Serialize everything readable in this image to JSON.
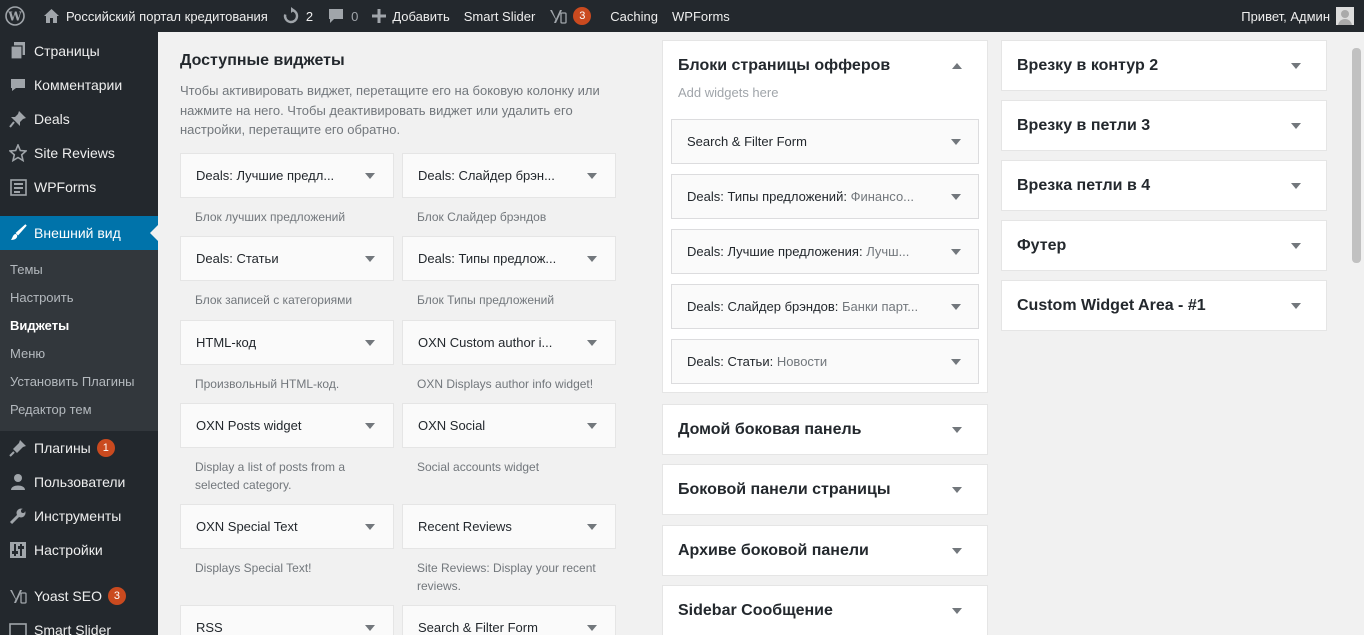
{
  "adminbar": {
    "site_name": "Российский портал кредитования",
    "updates_count": "2",
    "comments_count": "0",
    "add_label": "Добавить",
    "smart_slider_label": "Smart Slider",
    "yoast_count": "3",
    "caching_label": "Caching",
    "wpforms_label": "WPForms",
    "greeting": "Привет, Админ"
  },
  "sidebar": {
    "items_top": [
      {
        "label": "Страницы",
        "icon": "pages-icon"
      },
      {
        "label": "Комментарии",
        "icon": "comments-icon"
      },
      {
        "label": "Deals",
        "icon": "pin-icon"
      },
      {
        "label": "Site Reviews",
        "icon": "star-icon"
      },
      {
        "label": "WPForms",
        "icon": "forms-icon"
      }
    ],
    "current": {
      "label": "Внешний вид",
      "icon": "brush-icon"
    },
    "submenu": [
      "Темы",
      "Настроить",
      "Виджеты",
      "Меню",
      "Установить Плагины",
      "Редактор тем"
    ],
    "submenu_current": "Виджеты",
    "items_bottom": [
      {
        "label": "Плагины",
        "icon": "plugins-icon",
        "badge": "1"
      },
      {
        "label": "Пользователи",
        "icon": "users-icon"
      },
      {
        "label": "Инструменты",
        "icon": "tools-icon"
      },
      {
        "label": "Настройки",
        "icon": "settings-icon"
      }
    ],
    "yoast": {
      "label": "Yoast SEO",
      "badge": "3"
    },
    "smart_slider": {
      "label": "Smart Slider"
    }
  },
  "available": {
    "title": "Доступные виджеты",
    "description": "Чтобы активировать виджет, перетащите его на боковую колонку или нажмите на него. Чтобы деактивировать виджет или удалить его настройки, перетащите его обратно.",
    "widgets": [
      {
        "title": "Deals: Лучшие предл...",
        "desc": "Блок лучших предложений"
      },
      {
        "title": "Deals: Слайдер брэн...",
        "desc": "Блок Слайдер брэндов"
      },
      {
        "title": "Deals: Статьи",
        "desc": "Блок записей с категориями"
      },
      {
        "title": "Deals: Типы предлож...",
        "desc": "Блок Типы предложений"
      },
      {
        "title": "HTML-код",
        "desc": "Произвольный HTML-код."
      },
      {
        "title": "OXN Custom author i...",
        "desc": "OXN Displays author info widget!"
      },
      {
        "title": "OXN Posts widget",
        "desc": "Display a list of posts from a selected category."
      },
      {
        "title": "OXN Social",
        "desc": "Social accounts widget"
      },
      {
        "title": "OXN Special Text",
        "desc": "Displays Special Text!"
      },
      {
        "title": "Recent Reviews",
        "desc": "Site Reviews: Display your recent reviews."
      },
      {
        "title": "RSS",
        "desc": ""
      },
      {
        "title": "Search & Filter Form",
        "desc": ""
      }
    ]
  },
  "offers_area": {
    "title": "Блоки страницы офферов",
    "hint": "Add widgets here",
    "widgets": [
      {
        "title": "Search & Filter Form",
        "sub": ""
      },
      {
        "title": "Deals: Типы предложений:",
        "sub": " Финансо..."
      },
      {
        "title": "Deals: Лучшие предложения:",
        "sub": " Лучш..."
      },
      {
        "title": "Deals: Слайдер брэндов:",
        "sub": " Банки парт..."
      },
      {
        "title": "Deals: Статьи:",
        "sub": " Новости"
      }
    ]
  },
  "sidebars_col2": [
    "Домой боковая панель",
    "Боковой панели страницы",
    "Архиве боковой панели",
    "Sidebar Сообщение"
  ],
  "sidebars_col3": [
    "Врезку в контур 2",
    "Врезку в петли 3",
    "Врезка петли в 4",
    "Футер",
    "Custom Widget Area - #1"
  ]
}
